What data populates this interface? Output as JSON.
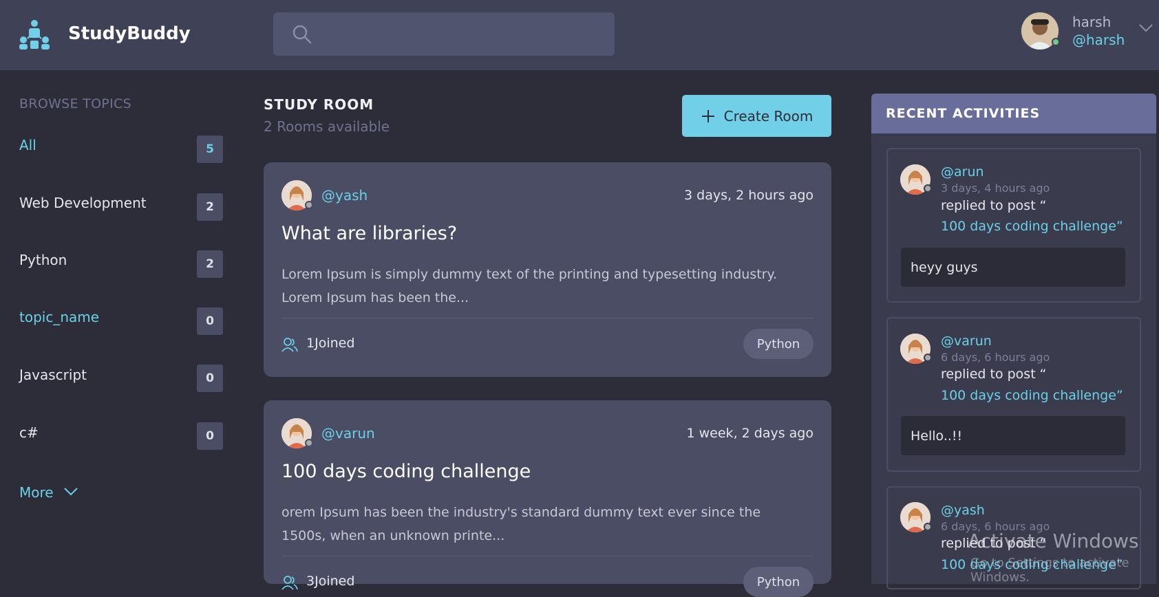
{
  "header": {
    "brand": "StudyBuddy",
    "search_placeholder": "",
    "user_name": "harsh",
    "user_handle": "@harsh"
  },
  "sidebar": {
    "title": "BROWSE TOPICS",
    "topics": [
      {
        "label": "All",
        "count": "5"
      },
      {
        "label": "Web Development",
        "count": "2"
      },
      {
        "label": "Python",
        "count": "2"
      },
      {
        "label": "topic_name",
        "count": "0"
      },
      {
        "label": "Javascript",
        "count": "0"
      },
      {
        "label": "c#",
        "count": "0"
      }
    ],
    "more_label": "More"
  },
  "main": {
    "title": "STUDY ROOM",
    "subtitle": "2 Rooms available",
    "create_label": "Create Room",
    "rooms": [
      {
        "user": "@yash",
        "time": "3 days, 2 hours ago",
        "title": "What are libraries?",
        "description": "Lorem Ipsum is simply dummy text of the printing and typesetting industry. Lorem Ipsum has been the...",
        "joined": "1Joined",
        "topic": "Python"
      },
      {
        "user": "@varun",
        "time": "1 week, 2 days ago",
        "title": "100 days coding challenge",
        "description": "orem Ipsum has been the industry's standard dummy text ever since the 1500s, when an unknown printe...",
        "joined": "3Joined",
        "topic": "Python"
      }
    ]
  },
  "activities": {
    "title": "RECENT ACTIVITIES",
    "items": [
      {
        "user": "@arun",
        "time": "3 days, 4 hours ago",
        "action": "replied to post “",
        "post": "100 days coding challenge”",
        "message": "heyy guys"
      },
      {
        "user": "@varun",
        "time": "6 days, 6 hours ago",
        "action": "replied to post “",
        "post": "100 days coding challenge”",
        "message": "Hello..!!"
      },
      {
        "user": "@yash",
        "time": "6 days, 6 hours ago",
        "action": "replied to post “",
        "post": "100 days coding challenge”"
      }
    ]
  },
  "watermark": {
    "line1": "Activate Windows",
    "line2": "Go to Settings to activate Windows."
  },
  "colors": {
    "accent": "#71cfe8",
    "background": "#2d2d39",
    "header": "#3f4156",
    "card": "#4a4d63",
    "activities_header": "#696d9a"
  }
}
